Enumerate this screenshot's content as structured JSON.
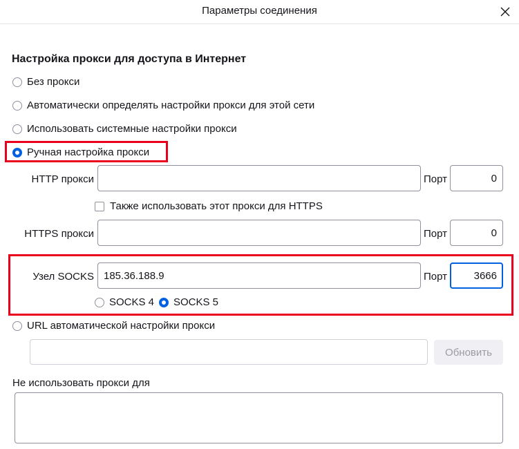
{
  "dialog": {
    "title": "Параметры соединения"
  },
  "section": {
    "heading": "Настройка прокси для доступа в Интернет"
  },
  "proxy_modes": {
    "none": "Без прокси",
    "auto_detect": "Автоматически определять настройки прокси для этой сети",
    "system": "Использовать системные настройки прокси",
    "manual": "Ручная настройка прокси",
    "selected": "manual"
  },
  "http": {
    "label": "HTTP прокси",
    "value": "",
    "port_label": "Порт",
    "port_value": "0"
  },
  "also_https": {
    "label": "Также использовать этот прокси для HTTPS",
    "checked": false
  },
  "https": {
    "label": "HTTPS прокси",
    "value": "",
    "port_label": "Порт",
    "port_value": "0"
  },
  "socks": {
    "label": "Узел SOCKS",
    "value": "185.36.188.9",
    "port_label": "Порт",
    "port_value": "3666",
    "v4_label": "SOCKS 4",
    "v5_label": "SOCKS 5",
    "selected_version": "v5"
  },
  "auto_url": {
    "label": "URL автоматической настройки прокси",
    "value": "",
    "reload_label": "Обновить"
  },
  "no_proxy": {
    "label": "Не использовать прокси для",
    "value": ""
  },
  "colors": {
    "accent": "#0061e0",
    "highlight": "#e8001c"
  },
  "icons": {
    "close": "close-icon"
  }
}
